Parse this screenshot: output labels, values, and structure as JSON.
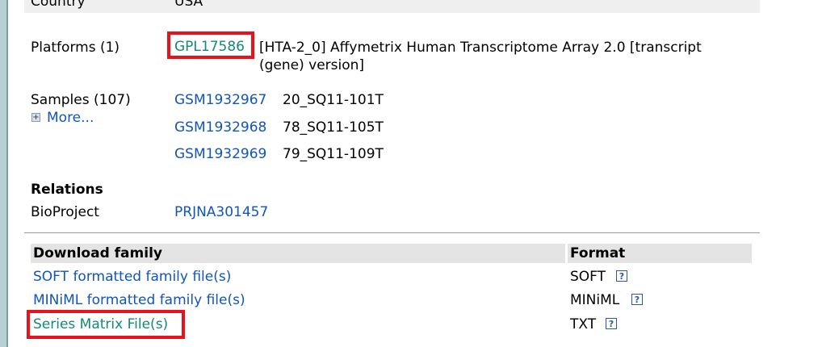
{
  "country": {
    "label": "Country",
    "value": "USA"
  },
  "platforms": {
    "label": "Platforms (1)",
    "id": "GPL17586",
    "description_line1": "[HTA-2_0] Affymetrix Human Transcriptome Array 2.0 [transcript",
    "description_line2": "(gene) version]"
  },
  "samples": {
    "label": "Samples (107)",
    "more_label": "More...",
    "items": [
      {
        "id": "GSM1932967",
        "title": "20_SQ11-101T"
      },
      {
        "id": "GSM1932968",
        "title": "78_SQ11-105T"
      },
      {
        "id": "GSM1932969",
        "title": "79_SQ11-109T"
      }
    ]
  },
  "relations": {
    "heading": "Relations",
    "bioproject_label": "BioProject",
    "bioproject_id": "PRJNA301457"
  },
  "downloads": {
    "col_family": "Download family",
    "col_format": "Format",
    "rows": [
      {
        "label": "SOFT formatted family file(s)",
        "format": "SOFT"
      },
      {
        "label": "MINiML formatted family file(s)",
        "format": "MINiML"
      },
      {
        "label": "Series Matrix File(s)",
        "format": "TXT"
      }
    ],
    "help_glyph": "?"
  },
  "colors": {
    "link": "#1155bb",
    "visited_link": "#13897a",
    "highlight": "#e8121e",
    "header_bg": "#e4e4e4"
  },
  "icons": {
    "more": "expand-plus-icon",
    "help": "help-question-icon"
  }
}
